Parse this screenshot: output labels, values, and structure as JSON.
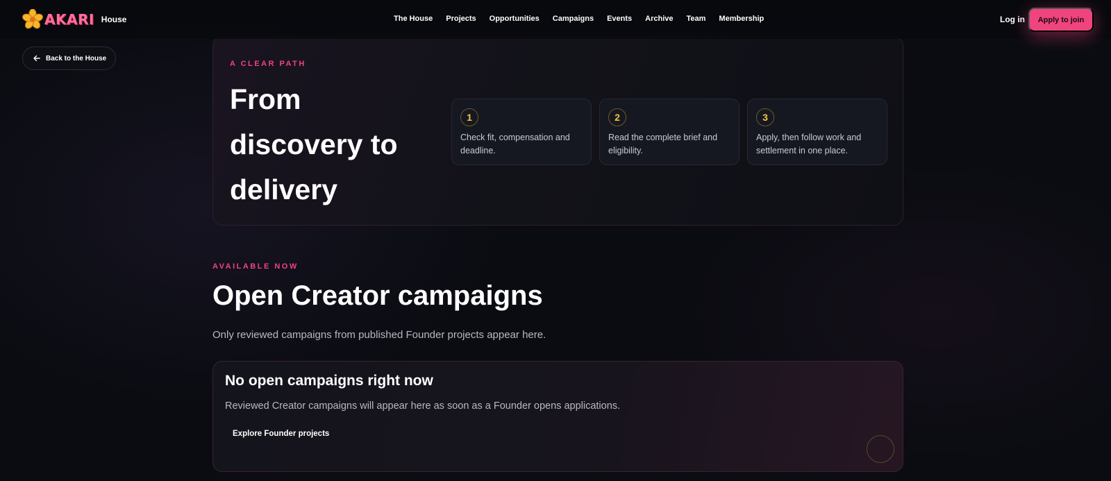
{
  "header": {
    "logo_word": "AKARI",
    "logo_suffix": "House",
    "nav": [
      "The House",
      "Projects",
      "Opportunities",
      "Campaigns",
      "Events",
      "Archive",
      "Team",
      "Membership"
    ],
    "login_label": "Log in",
    "apply_label": "Apply to join"
  },
  "back_button": {
    "label": "Back to the House",
    "icon": "arrow-left-icon"
  },
  "path_section": {
    "eyebrow": "A CLEAR PATH",
    "title": "From discovery to delivery",
    "steps": [
      {
        "number": "1",
        "text": "Check fit, compensation and deadline."
      },
      {
        "number": "2",
        "text": "Read the complete brief and eligibility."
      },
      {
        "number": "3",
        "text": "Apply, then follow work and settlement in one place."
      }
    ]
  },
  "campaigns_section": {
    "eyebrow": "AVAILABLE NOW",
    "title": "Open Creator campaigns",
    "description": "Only reviewed campaigns from published Founder projects appear here.",
    "empty_state": {
      "title": "No open campaigns right now",
      "description": "Reviewed Creator campaigns will appear here as soon as a Founder opens applications.",
      "link_label": "Explore Founder projects"
    }
  },
  "colors": {
    "accent": "#f0447f",
    "number_gold": "#f5c542",
    "background": "#0b0c12"
  }
}
